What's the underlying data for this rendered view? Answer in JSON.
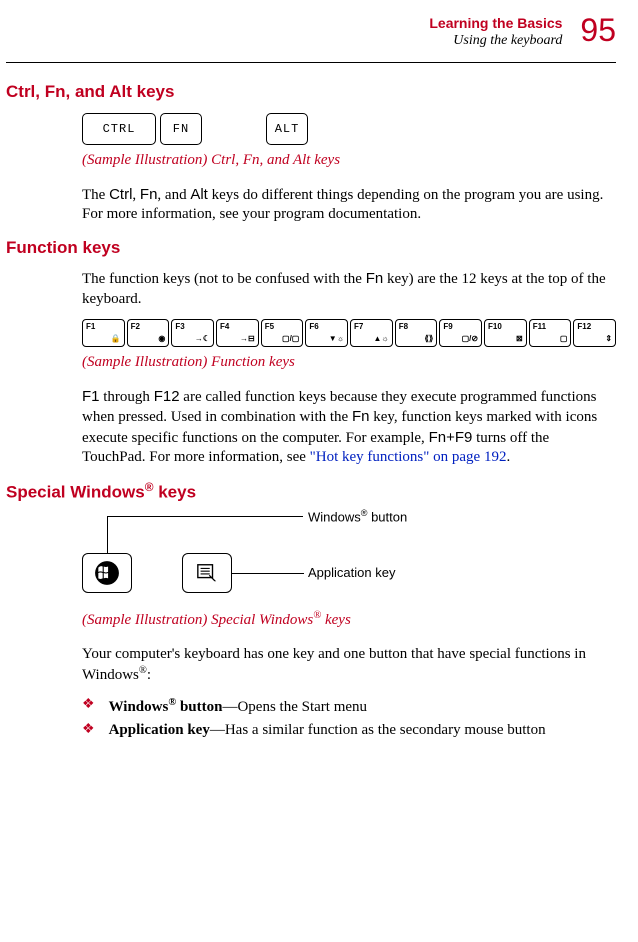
{
  "header": {
    "chapter": "Learning the Basics",
    "section": "Using the keyboard",
    "page": "95"
  },
  "s1": {
    "heading": "Ctrl, Fn, and Alt keys",
    "key_ctrl": "CTRL",
    "key_fn": "FN",
    "key_alt": "ALT",
    "caption": "(Sample Illustration) Ctrl, Fn, and Alt keys",
    "para_a": "The ",
    "k1": "Ctrl",
    "para_b": ", ",
    "k2": "Fn",
    "para_c": ", and ",
    "k3": "Alt",
    "para_d": " keys do different things depending on the program you are using. For more information, see your program documentation."
  },
  "s2": {
    "heading": "Function keys",
    "para1_a": "The function keys (not to be confused with the ",
    "para1_fn": "Fn",
    "para1_b": " key) are the 12 keys at the top of the keyboard.",
    "fkeys": [
      "F1",
      "F2",
      "F3",
      "F4",
      "F5",
      "F6",
      "F7",
      "F8",
      "F9",
      "F10",
      "F11",
      "F12"
    ],
    "caption": "(Sample Illustration) Function keys",
    "p2_a": "F1",
    "p2_b": " through ",
    "p2_c": "F12",
    "p2_d": " are called function keys because they execute programmed functions when pressed. Used in combination with the ",
    "p2_e": "Fn",
    "p2_f": " key, function keys marked with icons execute specific functions on the computer. For example, ",
    "p2_g": "Fn",
    "p2_h": "+",
    "p2_i": "F9",
    "p2_j": " turns off the TouchPad. For more information, see ",
    "p2_link": "\"Hot key functions\" on page 192",
    "p2_k": "."
  },
  "s3": {
    "heading_a": "Special Windows",
    "heading_sup": "®",
    "heading_b": " keys",
    "cl_win_a": "Windows",
    "cl_win_sup": "®",
    "cl_win_b": " button",
    "cl_app": "Application key",
    "caption_a": "(Sample Illustration) Special Windows",
    "caption_sup": "®",
    "caption_b": " keys",
    "p1_a": "Your computer's keyboard has one key and one button that have special functions in Windows",
    "p1_sup": "®",
    "p1_b": ":",
    "b1_a": "Windows",
    "b1_sup": "®",
    "b1_b": " button",
    "b1_c": "—Opens the Start menu",
    "b2_a": "Application key",
    "b2_b": "—Has a similar function as the secondary mouse button"
  }
}
